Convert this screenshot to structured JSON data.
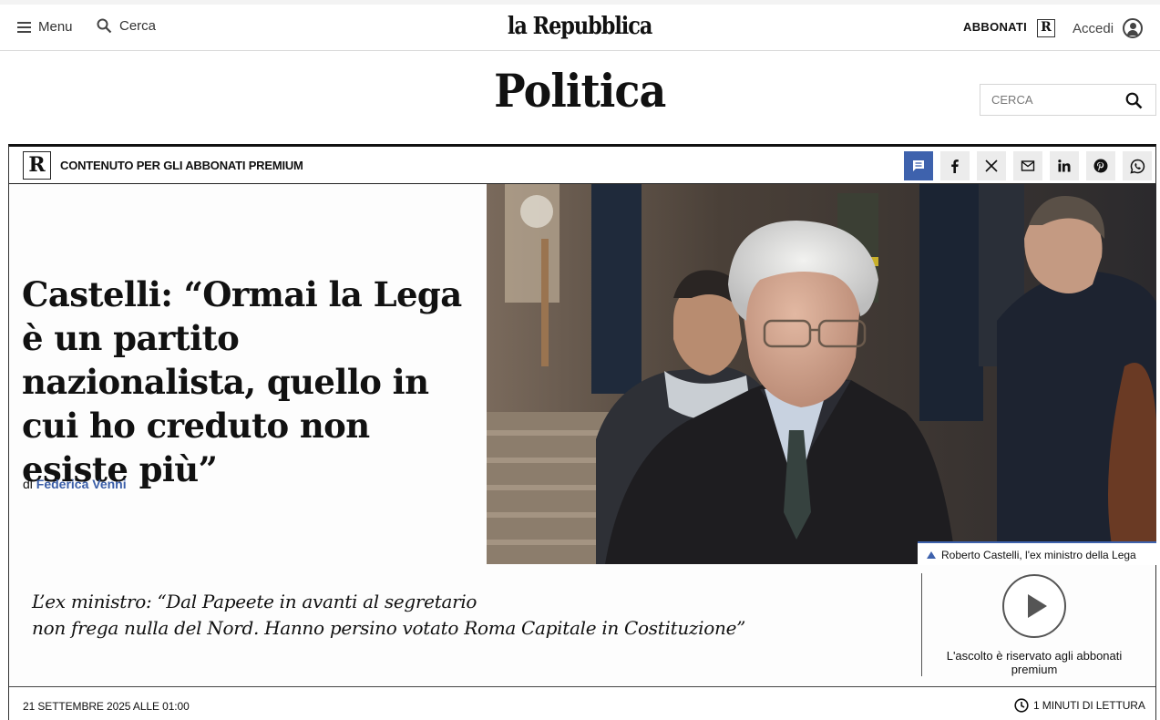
{
  "header": {
    "menu_label": "Menu",
    "search_label": "Cerca",
    "logo": "la Repubblica",
    "abbonati_label": "ABBONATI",
    "r_badge": "R",
    "login_label": "Accedi"
  },
  "section": {
    "title": "Politica",
    "search_placeholder": "CERCA"
  },
  "article": {
    "premium_badge": "R",
    "premium_label": "CONTENUTO PER GLI ABBONATI PREMIUM",
    "share_buttons": [
      "comment-icon",
      "facebook-icon",
      "x-icon",
      "mail-icon",
      "linkedin-icon",
      "pinterest-icon",
      "whatsapp-icon"
    ],
    "headline": "Castelli: “Ormai la Lega è un partito nazionalista, quello in cui ho creduto non esiste più”",
    "byline_prefix": "di",
    "author": "Federica Venni",
    "photo_caption": "Roberto Castelli, l'ex ministro della Lega",
    "summary_line1": "L’ex ministro: “Dal Papeete in avanti al segretario",
    "summary_line2": "non frega nulla del Nord. Hanno persino votato Roma Capitale in Costituzione”",
    "audio_note": "L'ascolto è riservato agli abbonati premium",
    "date": "21 SETTEMBRE 2025 ALLE 01:00",
    "read_time": "1 MINUTI DI LETTURA"
  },
  "colors": {
    "accent": "#3e62ad",
    "text": "#111111"
  }
}
